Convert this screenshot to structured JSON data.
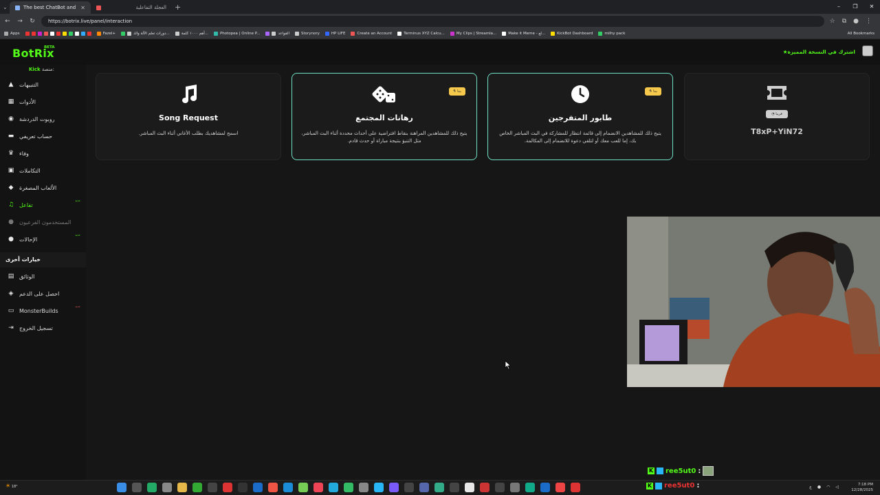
{
  "browser": {
    "tabs": [
      {
        "title": "The best ChatBot and Widgets",
        "active": true
      },
      {
        "title": "العجلة التفاعلية",
        "active": false
      }
    ],
    "url": "https://botrix.live/panel/interaction",
    "bookmarks": [
      "Apps",
      "Fazel+",
      "دورات تعلم الآلة والذ...",
      "أهم ١٠٠٠ كلمة...",
      "Photopea | Online P...",
      "القواعد",
      "Storynory",
      "HP LIFE",
      "Create an Account",
      "Terminus XYZ Calcu...",
      "My Clips | Streamla...",
      "Make it Meme - لع...",
      "KickBot Dashboard",
      "milhy pack"
    ],
    "all_bookmarks": "All Bookmarks"
  },
  "app": {
    "logo": "BotRix",
    "beta": "BETA",
    "premium": "اشترك في النسخة المميزة",
    "platform_label": "منصة:",
    "platform_value": "Kick"
  },
  "sidebar": {
    "items": [
      {
        "label": "التنبيهات",
        "icon": "warning-icon",
        "glyph": "▲"
      },
      {
        "label": "الأدوات",
        "icon": "grid-icon",
        "glyph": "▦"
      },
      {
        "label": "روبوت الدردشة",
        "icon": "robot-icon",
        "glyph": "◉"
      },
      {
        "label": "حساب تعريفي",
        "icon": "id-card-icon",
        "glyph": "▬"
      },
      {
        "label": "وفاء",
        "icon": "trophy-icon",
        "glyph": "♛"
      },
      {
        "label": "التكاملات",
        "icon": "integrations-icon",
        "glyph": "▣"
      },
      {
        "label": "الألعاب المصغرة",
        "icon": "gamepad-icon",
        "glyph": "◆"
      },
      {
        "label": "تفاعل",
        "icon": "music-icon",
        "glyph": "♫"
      },
      {
        "label": "المستخدمون الفرعيون",
        "icon": "users-icon",
        "glyph": "●"
      },
      {
        "label": "الإحالات",
        "icon": "referrals-icon",
        "glyph": "●"
      }
    ],
    "tag_new": "جديد",
    "section_title": "خيارات أخرى",
    "other_items": [
      {
        "label": "الوثائق",
        "icon": "book-icon",
        "glyph": "▤"
      },
      {
        "label": "احصل على الدعم",
        "icon": "discord-icon",
        "glyph": "◈"
      },
      {
        "label": "MonsterBuilds",
        "icon": "laptop-icon",
        "glyph": "▭"
      },
      {
        "label": "تسجيل الخروج",
        "icon": "logout-icon",
        "glyph": "⇥"
      }
    ]
  },
  "cards": [
    {
      "title": "Song Request",
      "desc": "اسمح لمشاهديك بطلب الأغاني أثناء البث المباشر.",
      "icon": "music-note-icon"
    },
    {
      "title": "رهانات المجتمع",
      "desc": "يتيح ذلك للمشاهدين المراهنة بنقاط افتراضية على أحداث محددة أثناء البث المباشر، مثل التنبؤ بنتيجة مباراة أو حدث قادم.",
      "icon": "dice-icon",
      "badge": "بيتا"
    },
    {
      "title": "طابور المتفرجين",
      "desc": "يتيح ذلك للمشاهدين الانضمام إلى قائمة انتظار للمشاركة في البث المباشر الخاص بك، إما للعب معك أو لتلقي دعوة للانضمام إلى المكالمة.",
      "icon": "clock-icon",
      "badge": "بيتا"
    },
    {
      "title": "T8xP+YiN72",
      "icon": "ticket-icon",
      "badge": "قريبا"
    }
  ],
  "chat": {
    "user": "ree5ut0",
    "colon": ":"
  },
  "taskbar": {
    "weather": "18°",
    "time": "7:18 PM",
    "date": "12/28/2025",
    "lang": "ع"
  },
  "colors": {
    "accent": "#53fc18",
    "card_highlight": "#6fe0c6",
    "badge": "#f6c84b"
  }
}
